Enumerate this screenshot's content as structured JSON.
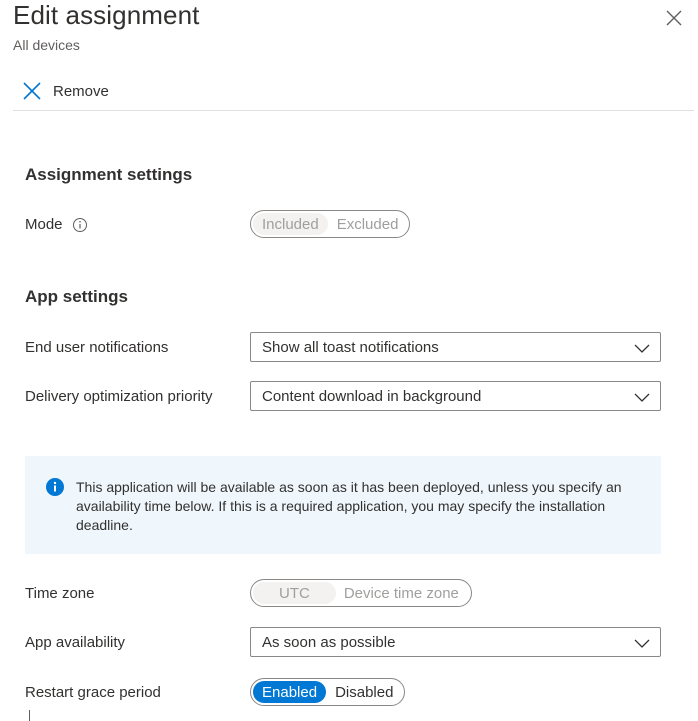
{
  "header": {
    "title": "Edit assignment",
    "subtitle": "All devices",
    "close_icon": "close-icon"
  },
  "toolbar": {
    "remove_label": "Remove",
    "remove_icon": "x-icon"
  },
  "assignment_settings": {
    "heading": "Assignment settings",
    "mode": {
      "label": "Mode",
      "options": [
        "Included",
        "Excluded"
      ],
      "selected": "Included"
    }
  },
  "app_settings": {
    "heading": "App settings",
    "end_user_notifications": {
      "label": "End user notifications",
      "value": "Show all toast notifications"
    },
    "delivery_optimization": {
      "label": "Delivery optimization priority",
      "value": "Content download in background"
    }
  },
  "info_message": {
    "text": "This application will be available as soon as it has been deployed, unless you specify an availability time below. If this is a required application, you may specify the installation deadline."
  },
  "time_zone": {
    "label": "Time zone",
    "options": [
      "UTC",
      "Device time zone"
    ],
    "selected": "UTC"
  },
  "app_availability": {
    "label": "App availability",
    "value": "As soon as possible"
  },
  "restart_grace": {
    "label": "Restart grace period",
    "options": [
      "Enabled",
      "Disabled"
    ],
    "selected": "Enabled"
  },
  "colors": {
    "accent": "#0078d4",
    "info_bg": "#eff6fc",
    "text": "#323130",
    "subtle": "#605e5c"
  }
}
